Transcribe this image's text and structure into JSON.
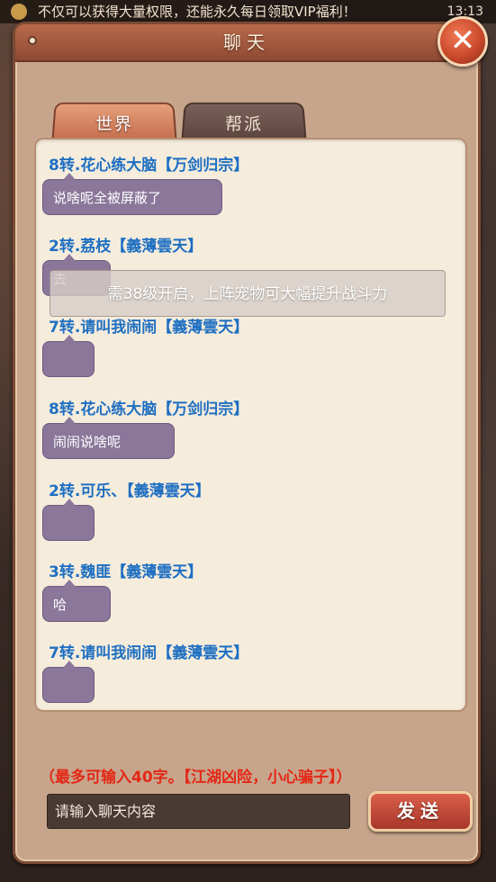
{
  "ticker": {
    "text": "不仅可以获得大量权限，还能永久每日领取VIP福利！",
    "time": "13:13"
  },
  "window": {
    "title": "聊天",
    "close_label": "✕"
  },
  "tabs": [
    {
      "label": "世界",
      "active": true
    },
    {
      "label": "帮派",
      "active": false
    }
  ],
  "messages": [
    {
      "sender": "8转.花心练大脑【万剑归宗】",
      "text": "说啥呢全被屏蔽了"
    },
    {
      "sender": "2转.荔枝【義薄雲天】",
      "text": "去"
    },
    {
      "sender": "7转.请叫我闹闹【義薄雲天】",
      "text": ""
    },
    {
      "sender": "8转.花心练大脑【万剑归宗】",
      "text": "闹闹说啥呢"
    },
    {
      "sender": "2转.可乐、【義薄雲天】",
      "text": ""
    },
    {
      "sender": "3转.魏匪【義薄雲天】",
      "text": "哈"
    },
    {
      "sender": "7转.请叫我闹闹【義薄雲天】",
      "text": ""
    }
  ],
  "toast": {
    "text": "需38级开启，上阵宠物可大幅提升战斗力"
  },
  "input": {
    "hint": "（最多可输入40字。【江湖凶险，小心骗子】）",
    "placeholder": "请输入聊天内容",
    "send_label": "发送"
  },
  "colors": {
    "sender": "#1e6fc2",
    "bubble": "#8a779a",
    "hint": "#e42816",
    "panel": "#c7a58c"
  }
}
